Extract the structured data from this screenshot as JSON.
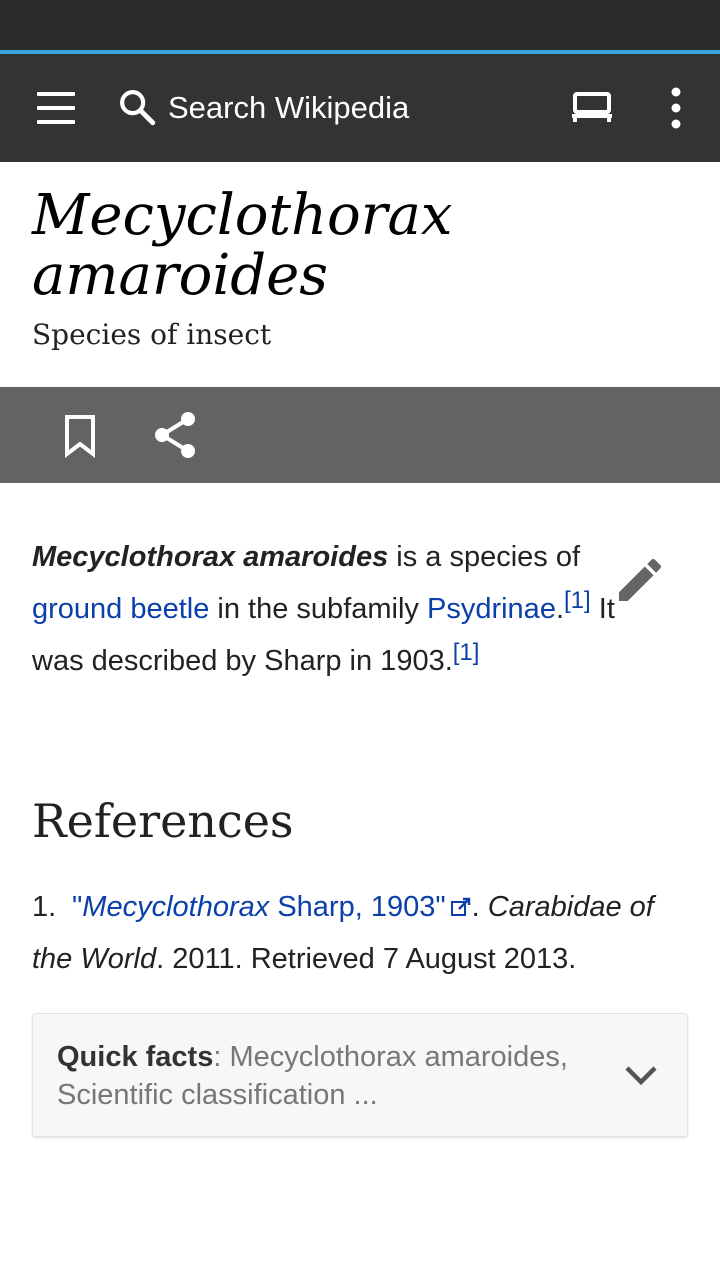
{
  "toolbar": {
    "search_placeholder": "Search Wikipedia",
    "icons": {
      "menu": "menu-icon",
      "search": "search-icon",
      "reading_list": "reading-list-icon",
      "more": "more-vert-icon"
    }
  },
  "article": {
    "title_line1": "Mecyclothorax",
    "title_line2": "amaroides",
    "description": "Species of insect",
    "lead": {
      "bold_name": "Mecyclothorax amaroides",
      "text1": " is a species of ",
      "link_ground_beetle": "ground beetle",
      "text2": " in the subfamily ",
      "link_psydrinae": "Psydrinae",
      "text3": ".",
      "cite1": "[1]",
      "text4": " It was described by Sharp in 1903.",
      "cite2": "[1]"
    }
  },
  "references": {
    "heading": "References",
    "items": [
      {
        "number": "1.",
        "link_open_quote": "\"",
        "link_italic": "Mecyclothorax",
        "link_rest": " Sharp, 1903\"",
        "sep": ". ",
        "publication": "Carabidae of the World",
        "tail": ". 2011. Retrieved 7 August 2013."
      }
    ]
  },
  "quick_facts": {
    "label": "Quick facts",
    "separator": ": ",
    "summary": "Mecyclothorax amaroides, Scientific classification ..."
  },
  "colors": {
    "toolbar_bg": "#333333",
    "progress": "#3aa5d9",
    "action_bar_bg": "#636363",
    "link": "#0b3fa9"
  }
}
